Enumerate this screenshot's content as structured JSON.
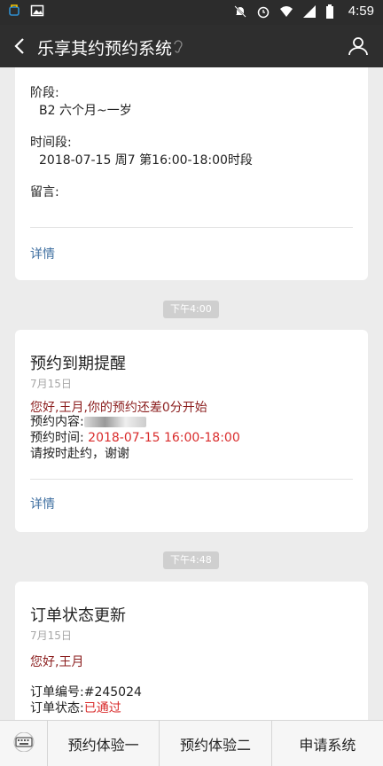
{
  "status_bar": {
    "time": "4:59"
  },
  "header": {
    "title": "乐享其约预约系统"
  },
  "card1": {
    "stage_label": "阶段:",
    "stage_value": "B2 六个月~一岁",
    "period_label": "时间段:",
    "period_value": "2018-07-15 周7 第16:00-18:00时段",
    "message_label": "留言:",
    "detail_link": "详情"
  },
  "stamp1": "下午4:00",
  "card2": {
    "title": "预约到期提醒",
    "date": "7月15日",
    "greeting": "您好,王月,你的预约还差0分开始",
    "content_label": "预约内容:",
    "time_label": "预约时间:",
    "time_value": "2018-07-15 16:00-18:00",
    "notice": "请按时赴约，谢谢",
    "detail_link": "详情"
  },
  "stamp2": "下午4:48",
  "card3": {
    "title": "订单状态更新",
    "date": "7月15日",
    "greeting": "您好,王月",
    "order_no_label": "订单编号:",
    "order_no_value": "#245024",
    "order_status_label": "订单状态:",
    "order_status_value": "已通过"
  },
  "menu": {
    "btn1": "预约体验一",
    "btn2": "预约体验二",
    "btn3": "申请系统"
  }
}
